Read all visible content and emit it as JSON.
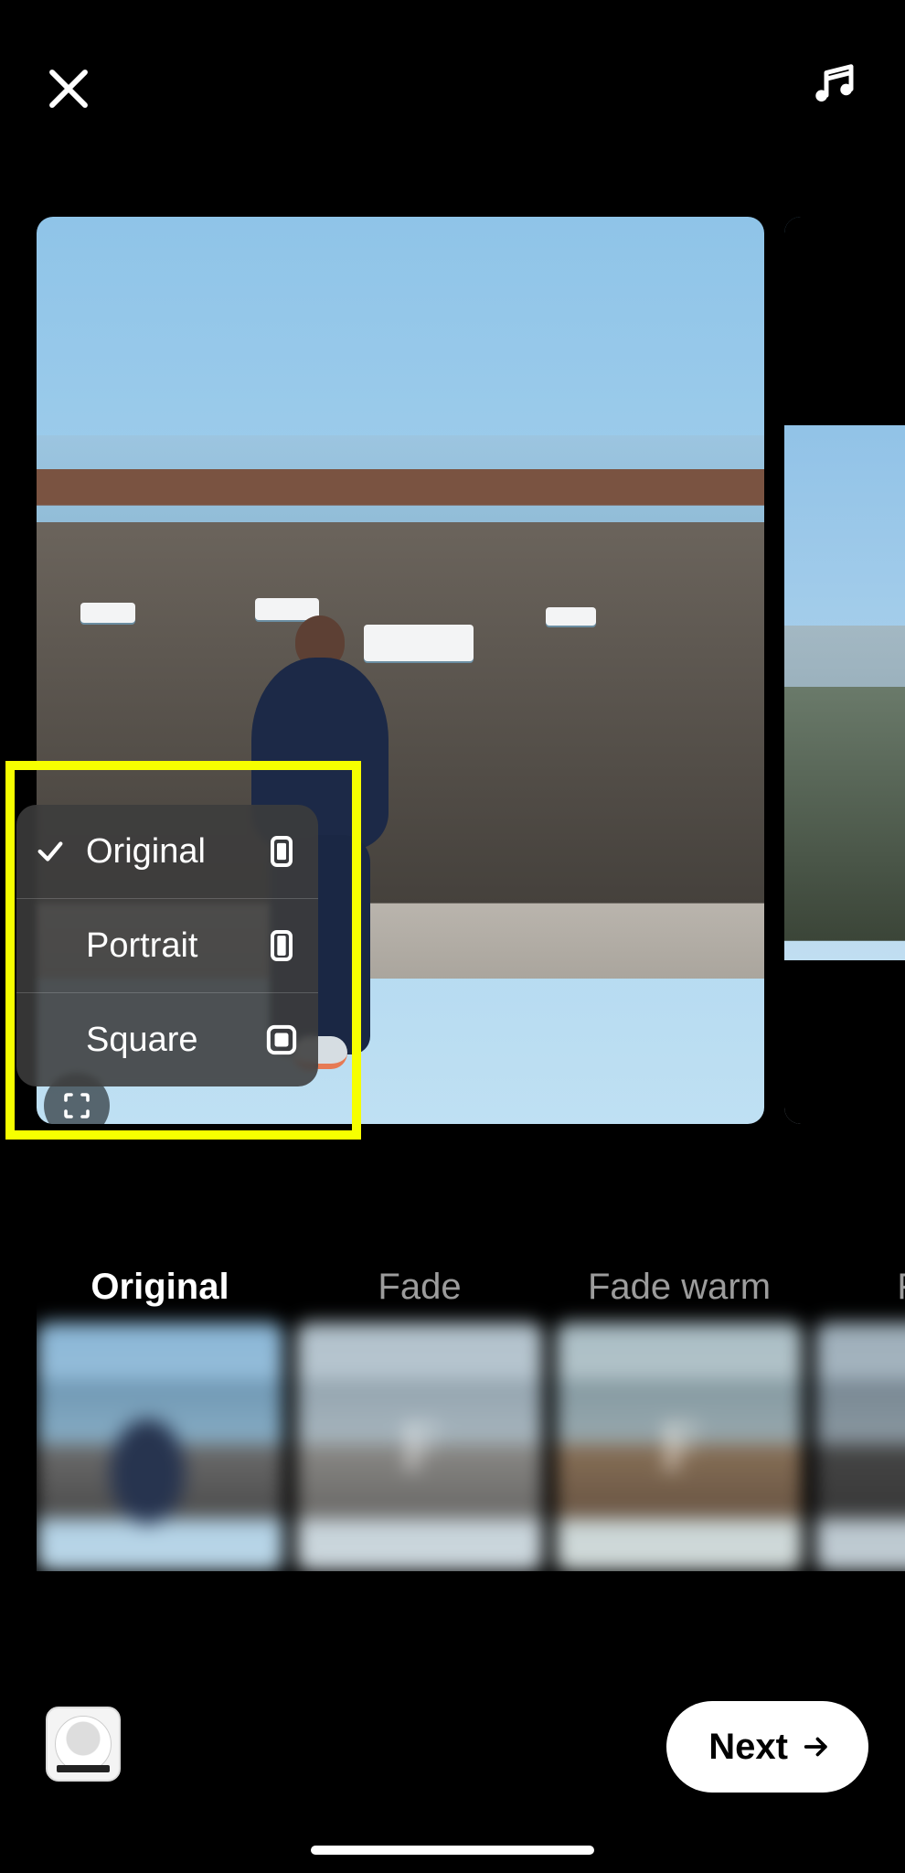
{
  "topbar": {
    "close_name": "close-icon",
    "music_name": "music-icon"
  },
  "aspect_menu": {
    "items": [
      {
        "label": "Original",
        "selected": true,
        "shape": "original"
      },
      {
        "label": "Portrait",
        "selected": false,
        "shape": "portrait"
      },
      {
        "label": "Square",
        "selected": false,
        "shape": "square"
      }
    ]
  },
  "crop_button_name": "crop-aspect-icon",
  "filters": [
    {
      "label": "Original",
      "active": true,
      "thumb_class": "orig",
      "letter": ""
    },
    {
      "label": "Fade",
      "active": false,
      "thumb_class": "fade",
      "letter": "F"
    },
    {
      "label": "Fade warm",
      "active": false,
      "thumb_class": "fadewarm",
      "letter": "F"
    },
    {
      "label": "Fade",
      "active": false,
      "thumb_class": "fade4",
      "letter": ""
    }
  ],
  "bottom": {
    "next_label": "Next",
    "gallery_name": "gallery-thumbnail"
  }
}
